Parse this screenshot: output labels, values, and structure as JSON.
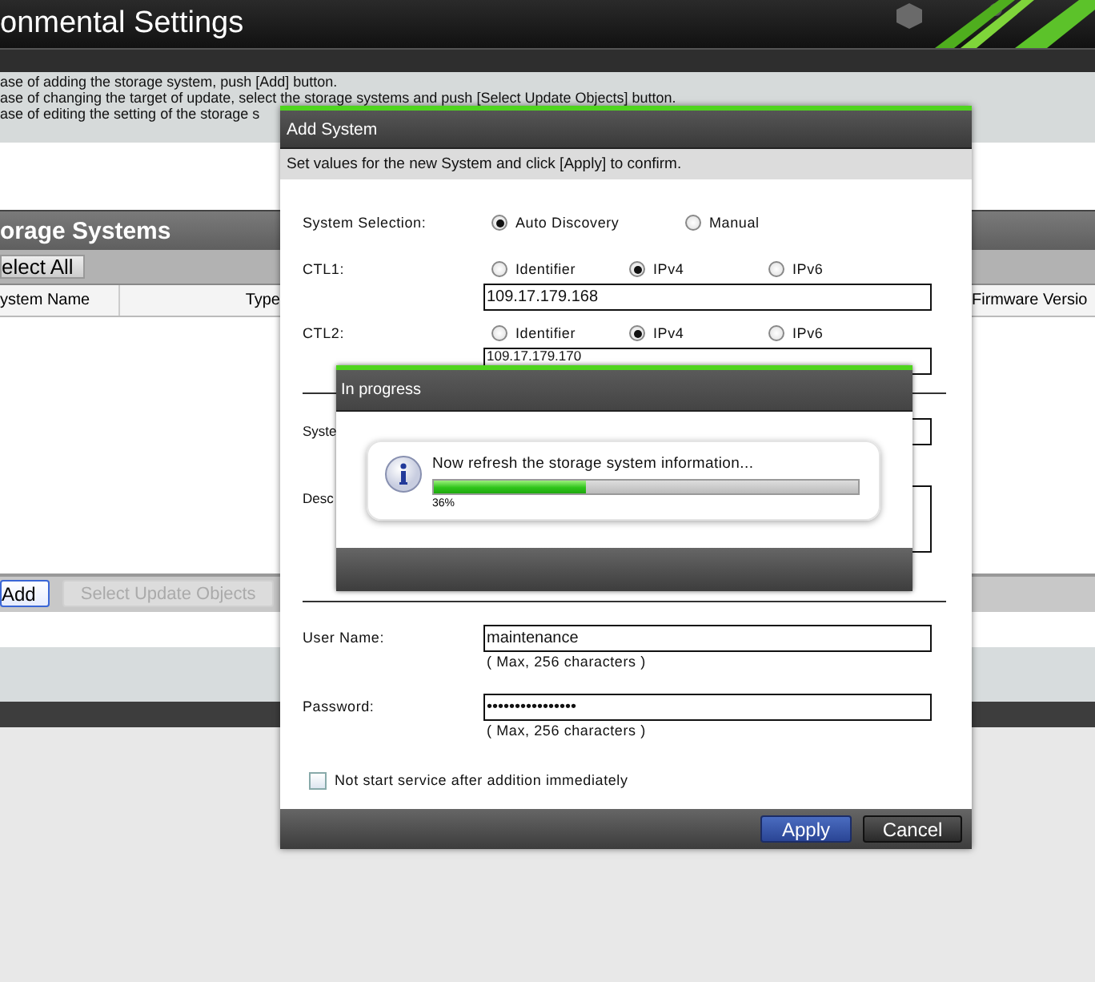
{
  "page": {
    "title": "onmental Settings",
    "instructions": [
      "ase of adding the storage system, push [Add] button.",
      "ase of changing the target of update, select the storage systems and push [Select Update Objects] button.",
      "ase of editing the setting of the storage s"
    ],
    "section_title": "orage Systems",
    "select_all_button": "elect All",
    "columns": [
      "ystem Name",
      "Type",
      "Firmware Versio"
    ],
    "buttons": [
      {
        "label": "Add",
        "disabled": false
      },
      {
        "label": "Select Update Objects",
        "disabled": true
      }
    ]
  },
  "add_dialog": {
    "title": "Add System",
    "instruction": "Set values for the new System and click [Apply] to confirm.",
    "system_selection": {
      "label": "System Selection:",
      "options": [
        {
          "label": "Auto Discovery",
          "selected": true
        },
        {
          "label": "Manual",
          "selected": false
        }
      ]
    },
    "controllers": [
      {
        "label": "CTL1:",
        "options": [
          {
            "label": "Identifier",
            "selected": false
          },
          {
            "label": "IPv4",
            "selected": true
          },
          {
            "label": "IPv6",
            "selected": false
          }
        ],
        "value": "109.17.179.168"
      },
      {
        "label": "CTL2:",
        "options": [
          {
            "label": "Identifier",
            "selected": false
          },
          {
            "label": "IPv4",
            "selected": true
          },
          {
            "label": "IPv6",
            "selected": false
          }
        ],
        "value": "109.17.179.170"
      }
    ],
    "system_name_label": "Syste",
    "description_label": "Desc",
    "user_name": {
      "label": "User Name:",
      "value": "maintenance",
      "hint": "( Max, 256 characters )"
    },
    "password": {
      "label": "Password:",
      "value": "••••••••••••••••",
      "hint": "( Max, 256 characters )"
    },
    "checkbox": {
      "label": "Not start service after addition immediately",
      "checked": false
    },
    "buttons": [
      {
        "label": "Apply",
        "kind": "primary"
      },
      {
        "label": "Cancel",
        "kind": "secondary"
      }
    ]
  },
  "progress_dialog": {
    "title": "In progress",
    "message": "Now refresh the storage system information...",
    "level": 0.36,
    "percent": "36%"
  }
}
